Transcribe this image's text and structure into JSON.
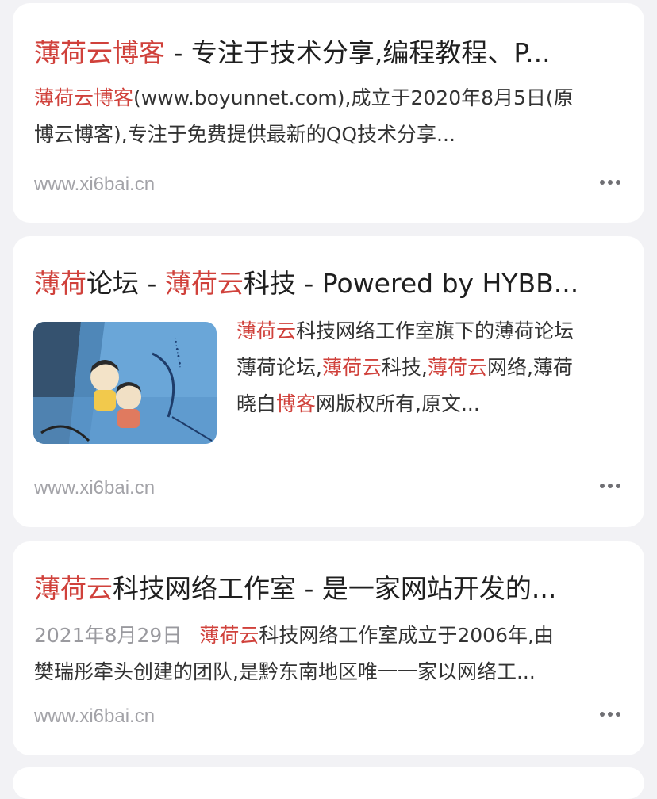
{
  "results": [
    {
      "title_hl": "薄荷云博客",
      "title_rest": " - 专注于技术分享,编程教程、P...",
      "snippet_l1_hl": "薄荷云博客",
      "snippet_l1_rest": "(www.boyunnet.com),成立于2020年8月5日(原",
      "snippet_l2": "博云博客),专注于免费提供最新的QQ技术分享...",
      "site": "www.xi6bai.cn"
    },
    {
      "title_hl1": "薄荷",
      "title_mid": "论坛 - ",
      "title_hl2": "薄荷云",
      "title_rest": "科技 - Powered by HYBB...",
      "line1_hl": "薄荷云",
      "line1_rest": "科技网络工作室旗下的薄荷论坛",
      "line2_a": "薄荷论坛,",
      "line2_hl1": "薄荷云",
      "line2_b": "科技,",
      "line2_hl2": "薄荷云",
      "line2_c": "网络,薄荷",
      "line3_a": "晓白",
      "line3_hl": "博客",
      "line3_b": "网版权所有,原文...",
      "site": "www.xi6bai.cn"
    },
    {
      "title_hl": "薄荷云",
      "title_rest": "科技网络工作室 - 是一家网站开发的...",
      "date": "2021年8月29日",
      "line1_hl": "薄荷云",
      "line1_rest": "科技网络工作室成立于2006年,由",
      "line2": "樊瑞彤牵头创建的团队,是黔东南地区唯一一家以网络工...",
      "site": "www.xi6bai.cn"
    }
  ],
  "colors": {
    "highlight": "#d0413b",
    "site": "#a3a3a8",
    "background": "#f2f2f5"
  },
  "icons": {
    "more": "more-dots-icon"
  }
}
